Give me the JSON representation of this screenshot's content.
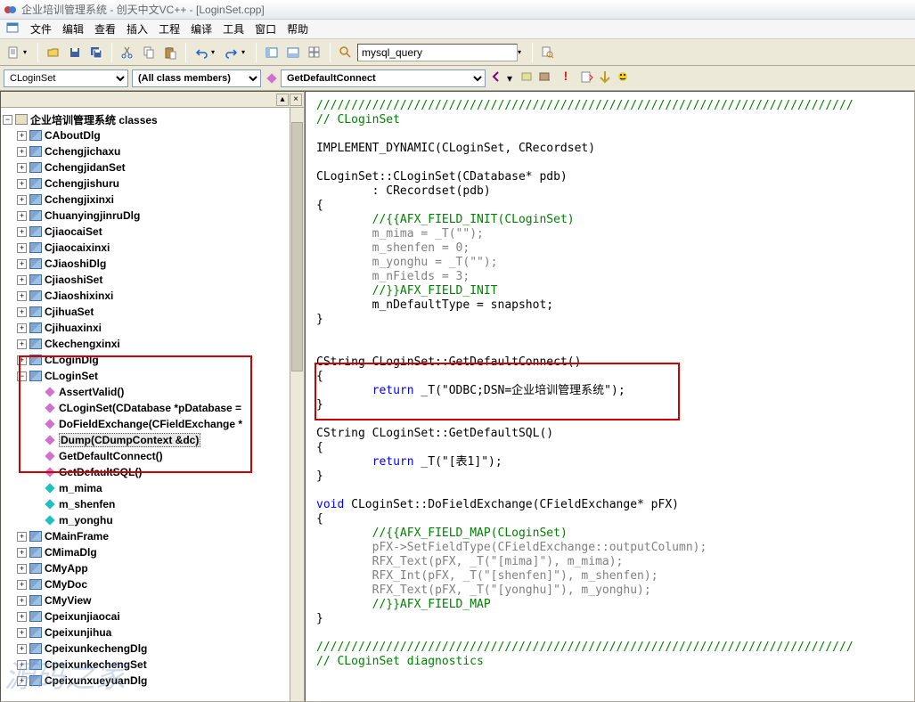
{
  "title": "企业培训管理系统 - 创天中文VC++ - [LoginSet.cpp]",
  "menus": [
    "文件",
    "编辑",
    "查看",
    "插入",
    "工程",
    "编译",
    "工具",
    "窗口",
    "帮助"
  ],
  "search_box": "mysql_query",
  "dropdown1": "CLoginSet",
  "dropdown2": "(All class members)",
  "dropdown3": "GetDefaultConnect",
  "tree_root": "企业培训管理系统 classes",
  "classes": [
    "CAboutDlg",
    "Cchengjichaxu",
    "CchengjidanSet",
    "Cchengjishuru",
    "Cchengjixinxi",
    "ChuanyingjinruDlg",
    "CjiaocaiSet",
    "Cjiaocaixinxi",
    "CJiaoshiDlg",
    "CjiaoshiSet",
    "CJiaoshixinxi",
    "CjihuaSet",
    "Cjihuaxinxi",
    "Ckechengxinxi",
    "CLoginDlg"
  ],
  "loginset": {
    "name": "CLoginSet",
    "methods": [
      "AssertValid()",
      "CLoginSet(CDatabase *pDatabase =",
      "DoFieldExchange(CFieldExchange *",
      "Dump(CDumpContext &dc)",
      "GetDefaultConnect()",
      "GetDefaultSQL()"
    ],
    "selected_idx": 3,
    "members": [
      "m_mima",
      "m_shenfen",
      "m_yonghu"
    ]
  },
  "classes_after": [
    "CMainFrame",
    "CMimaDlg",
    "CMyApp",
    "CMyDoc",
    "CMyView",
    "Cpeixunjiaocai",
    "Cpeixunjihua",
    "CpeixunkechengDlg",
    "CpeixunkechengSet",
    "CpeixunxueyuanDlg"
  ],
  "code": {
    "divider": "/////////////////////////////////////////////////////////////////////////////",
    "c1": "// CLoginSet",
    "l1": "IMPLEMENT_DYNAMIC(CLoginSet, CRecordset)",
    "l2": "CLoginSet::CLoginSet(CDatabase* pdb)",
    "l3": "\t: CRecordset(pdb)",
    "l4": "{",
    "l5": "\t//{{AFX_FIELD_INIT(CLoginSet)",
    "l6": "\tm_mima = _T(\"\");",
    "l7": "\tm_shenfen = 0;",
    "l8": "\tm_yonghu = _T(\"\");",
    "l9": "\tm_nFields = 3;",
    "l10": "\t//}}AFX_FIELD_INIT",
    "l11": "\tm_nDefaultType = snapshot;",
    "l12": "}",
    "l13": "CString CLoginSet::GetDefaultConnect()",
    "l14": "{",
    "kw_return": "return",
    "l15a": "_T(",
    "l15b": "\"ODBC;DSN=企业培训管理系统\"",
    "l15c": ");",
    "l16": "}",
    "l17": "CString CLoginSet::GetDefaultSQL()",
    "l18": "{",
    "l19b": "_T(",
    "l19c": "\"[表1]\"",
    "l19d": ");",
    "l20": "}",
    "kw_void": "void",
    "l21": " CLoginSet::DoFieldExchange(CFieldExchange* pFX)",
    "l22": "{",
    "l23": "\t//{{AFX_FIELD_MAP(CLoginSet)",
    "l24": "\tpFX->SetFieldType(CFieldExchange::outputColumn);",
    "l25": "\tRFX_Text(pFX, _T(\"[mima]\"), m_mima);",
    "l26": "\tRFX_Int(pFX, _T(\"[shenfen]\"), m_shenfen);",
    "l27": "\tRFX_Text(pFX, _T(\"[yonghu]\"), m_yonghu);",
    "l28": "\t//}}AFX_FIELD_MAP",
    "l29": "}",
    "c2": "// CLoginSet diagnostics"
  },
  "watermark": "源码之家"
}
